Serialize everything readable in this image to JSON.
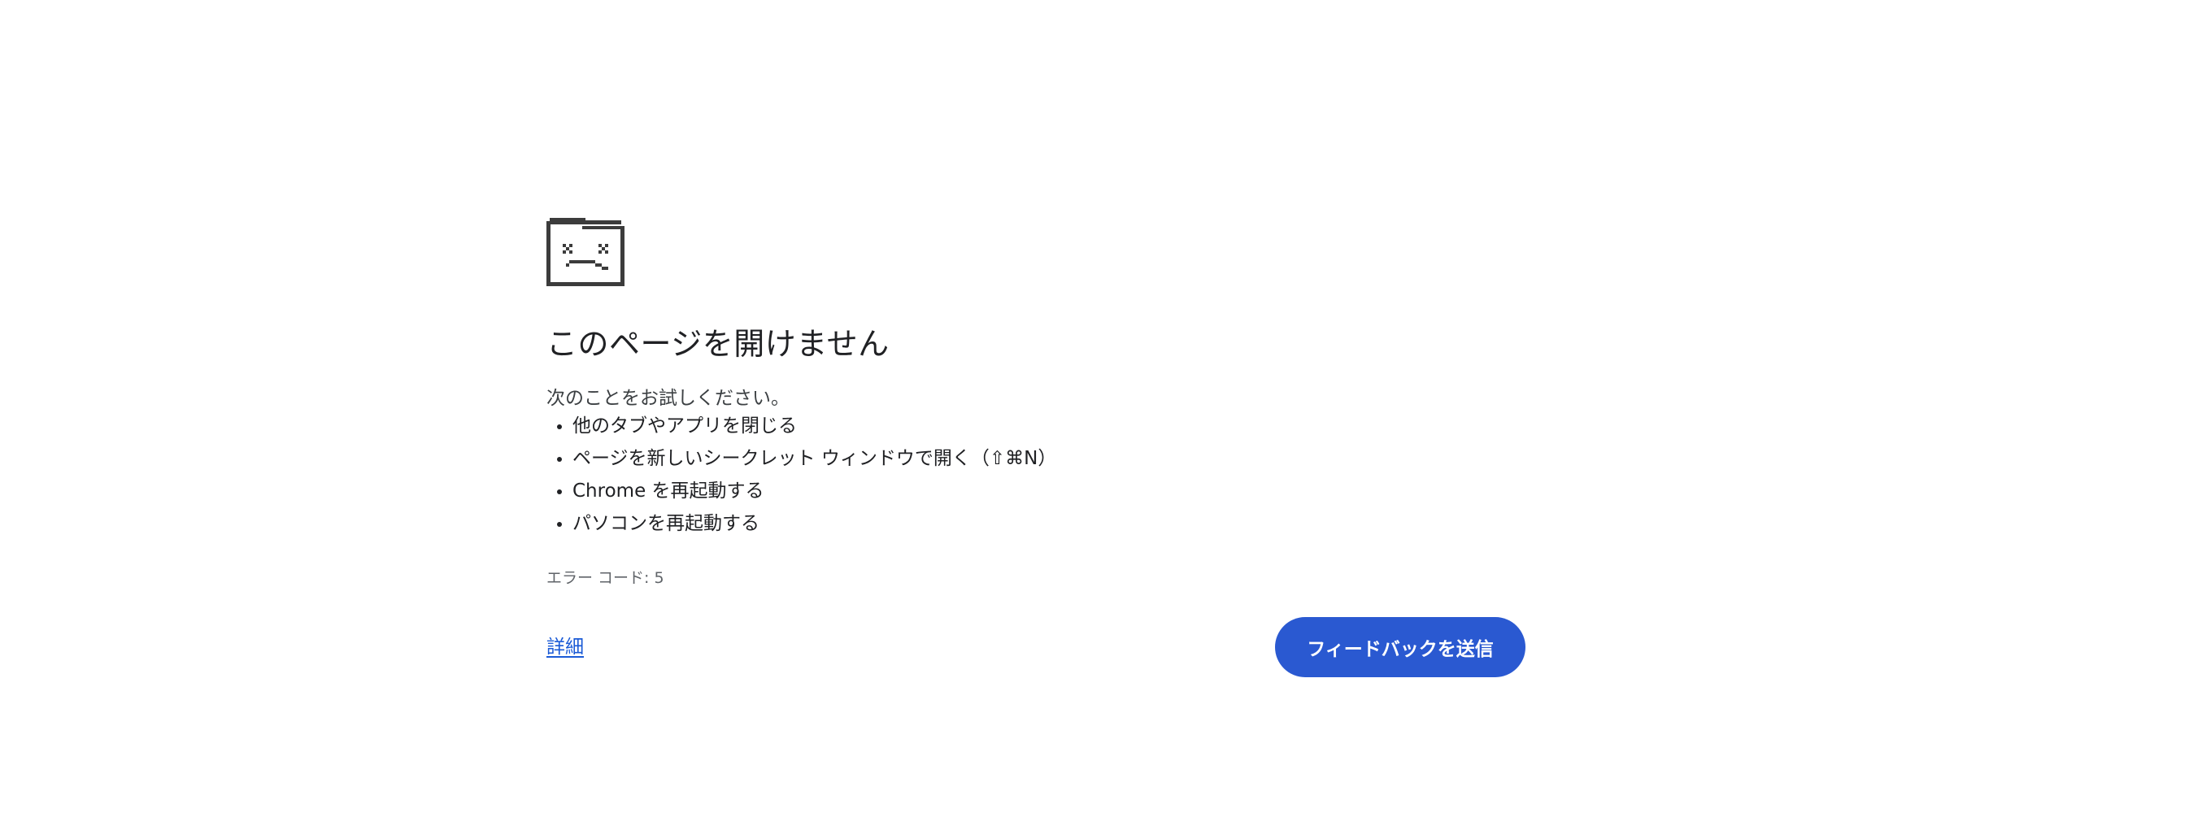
{
  "page": {
    "icon": "sad-folder-icon",
    "title": "このページを開けません",
    "intro": "次のことをお試しください。",
    "suggestions": [
      "他のタブやアプリを閉じる",
      "ページを新しいシークレット ウィンドウで開く（⇧⌘N）",
      "Chrome を再起動する",
      "パソコンを再起動する"
    ],
    "error_code": "エラー コード: 5",
    "details_label": "詳細",
    "feedback_label": "フィードバックを送信"
  },
  "colors": {
    "accent": "#2a59d1",
    "link": "#1a5ad6",
    "icon": "#3c3c3c",
    "text": "#202124"
  }
}
